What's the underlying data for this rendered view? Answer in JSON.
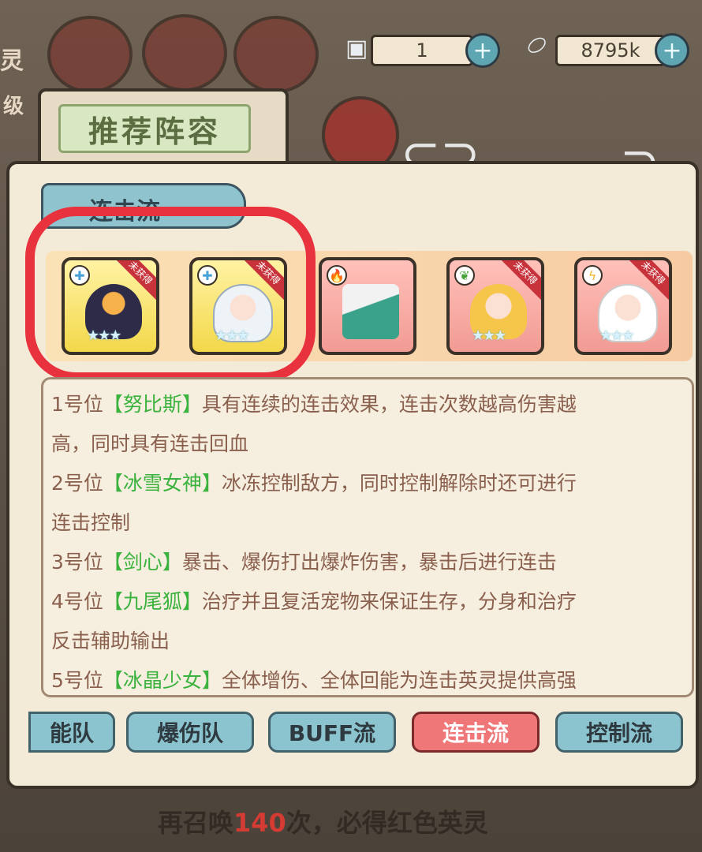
{
  "top_bar": {
    "left_partial_text": "灵",
    "ticket_count": "1",
    "currency_amount": "8795k",
    "plus_symbol": "+"
  },
  "side_partial_text": "级",
  "ribbon_title": "推荐阵容",
  "panel": {
    "tab_label": "连击流",
    "heroes": [
      {
        "position": 1,
        "rarity": "yellow",
        "badge": "未获得",
        "element_icon": "plus-cross-icon"
      },
      {
        "position": 2,
        "rarity": "yellow",
        "badge": "未获得",
        "element_icon": "plus-cross-icon"
      },
      {
        "position": 3,
        "rarity": "red",
        "badge": "",
        "element_icon": "fire-icon"
      },
      {
        "position": 4,
        "rarity": "red",
        "badge": "未获得",
        "element_icon": "leaf-icon"
      },
      {
        "position": 5,
        "rarity": "red",
        "badge": "未获得",
        "element_icon": "lightning-icon"
      }
    ],
    "stars": "★★★",
    "description_lines": [
      {
        "pre": "1号位",
        "name": "【努比斯】",
        "post": "具有连续的连击效果，连击次数越高伤害越"
      },
      {
        "pre": "高，同时具有连击回血",
        "name": "",
        "post": ""
      },
      {
        "pre": "2号位",
        "name": "【冰雪女神】",
        "post": "冰冻控制敌方，同时控制解除时还可进行"
      },
      {
        "pre": "连击控制",
        "name": "",
        "post": ""
      },
      {
        "pre": "3号位",
        "name": "【剑心】",
        "post": "暴击、爆伤打出爆炸伤害，暴击后进行连击"
      },
      {
        "pre": "4号位",
        "name": "【九尾狐】",
        "post": "治疗并且复活宠物来保证生存，分身和治疗"
      },
      {
        "pre": "反击辅助输出",
        "name": "",
        "post": ""
      },
      {
        "pre": "5号位",
        "name": "【冰晶少女】",
        "post": "全体增伤、全体回能为连击英灵提供高强"
      }
    ]
  },
  "tabs": [
    {
      "label": "能队",
      "active": false
    },
    {
      "label": "爆伤队",
      "active": false
    },
    {
      "label": "BUFF流",
      "active": false
    },
    {
      "label": "连击流",
      "active": true
    },
    {
      "label": "控制流",
      "active": false
    }
  ],
  "bottom_message": {
    "pre": "再召唤",
    "count": "140",
    "post": "次，必得红色英灵"
  },
  "colors": {
    "highlight_circle": "#e8323e",
    "hero_name": "#3bb23d",
    "active_tab": "#ef7777",
    "tab": "#8bc3ce"
  }
}
